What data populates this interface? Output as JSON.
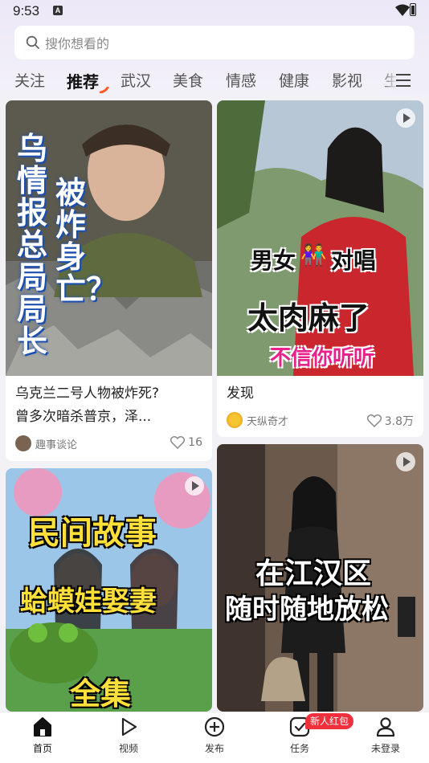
{
  "status_bar": {
    "time": "9:53",
    "notif": "A"
  },
  "search": {
    "placeholder": "搜你想看的"
  },
  "tabs": [
    {
      "label": "关注"
    },
    {
      "label": "推荐"
    },
    {
      "label": "武汉"
    },
    {
      "label": "美食"
    },
    {
      "label": "情感"
    },
    {
      "label": "健康"
    },
    {
      "label": "影视"
    },
    {
      "label": "生"
    }
  ],
  "cards": [
    {
      "overlay": [
        "乌情报总局局长",
        "被炸身亡？"
      ],
      "title_lines": [
        "乌克兰二号人物被炸死?",
        "曾多次暗杀普京，泽..."
      ],
      "author": "趣事谈论",
      "likes": "16"
    },
    {
      "overlay": [
        "男女",
        "对唱",
        "太肉麻了",
        "不信你听听"
      ],
      "title_lines": [
        "发现"
      ],
      "author": "天纵奇才",
      "likes": "3.8万"
    },
    {
      "overlay": [
        "民间故事",
        "蛤蟆娃娶妻",
        "全集"
      ]
    },
    {
      "overlay": [
        "在江汉区",
        "随时随地放松"
      ]
    }
  ],
  "nav": [
    {
      "label": "首页",
      "icon": "home-icon"
    },
    {
      "label": "视频",
      "icon": "play-icon"
    },
    {
      "label": "发布",
      "icon": "plus-icon"
    },
    {
      "label": "任务",
      "icon": "task-icon"
    },
    {
      "label": "未登录",
      "icon": "user-icon"
    }
  ],
  "badge": "新人红包",
  "colors": {
    "accent": "#ff5a1f",
    "badge": "#f0303d"
  }
}
